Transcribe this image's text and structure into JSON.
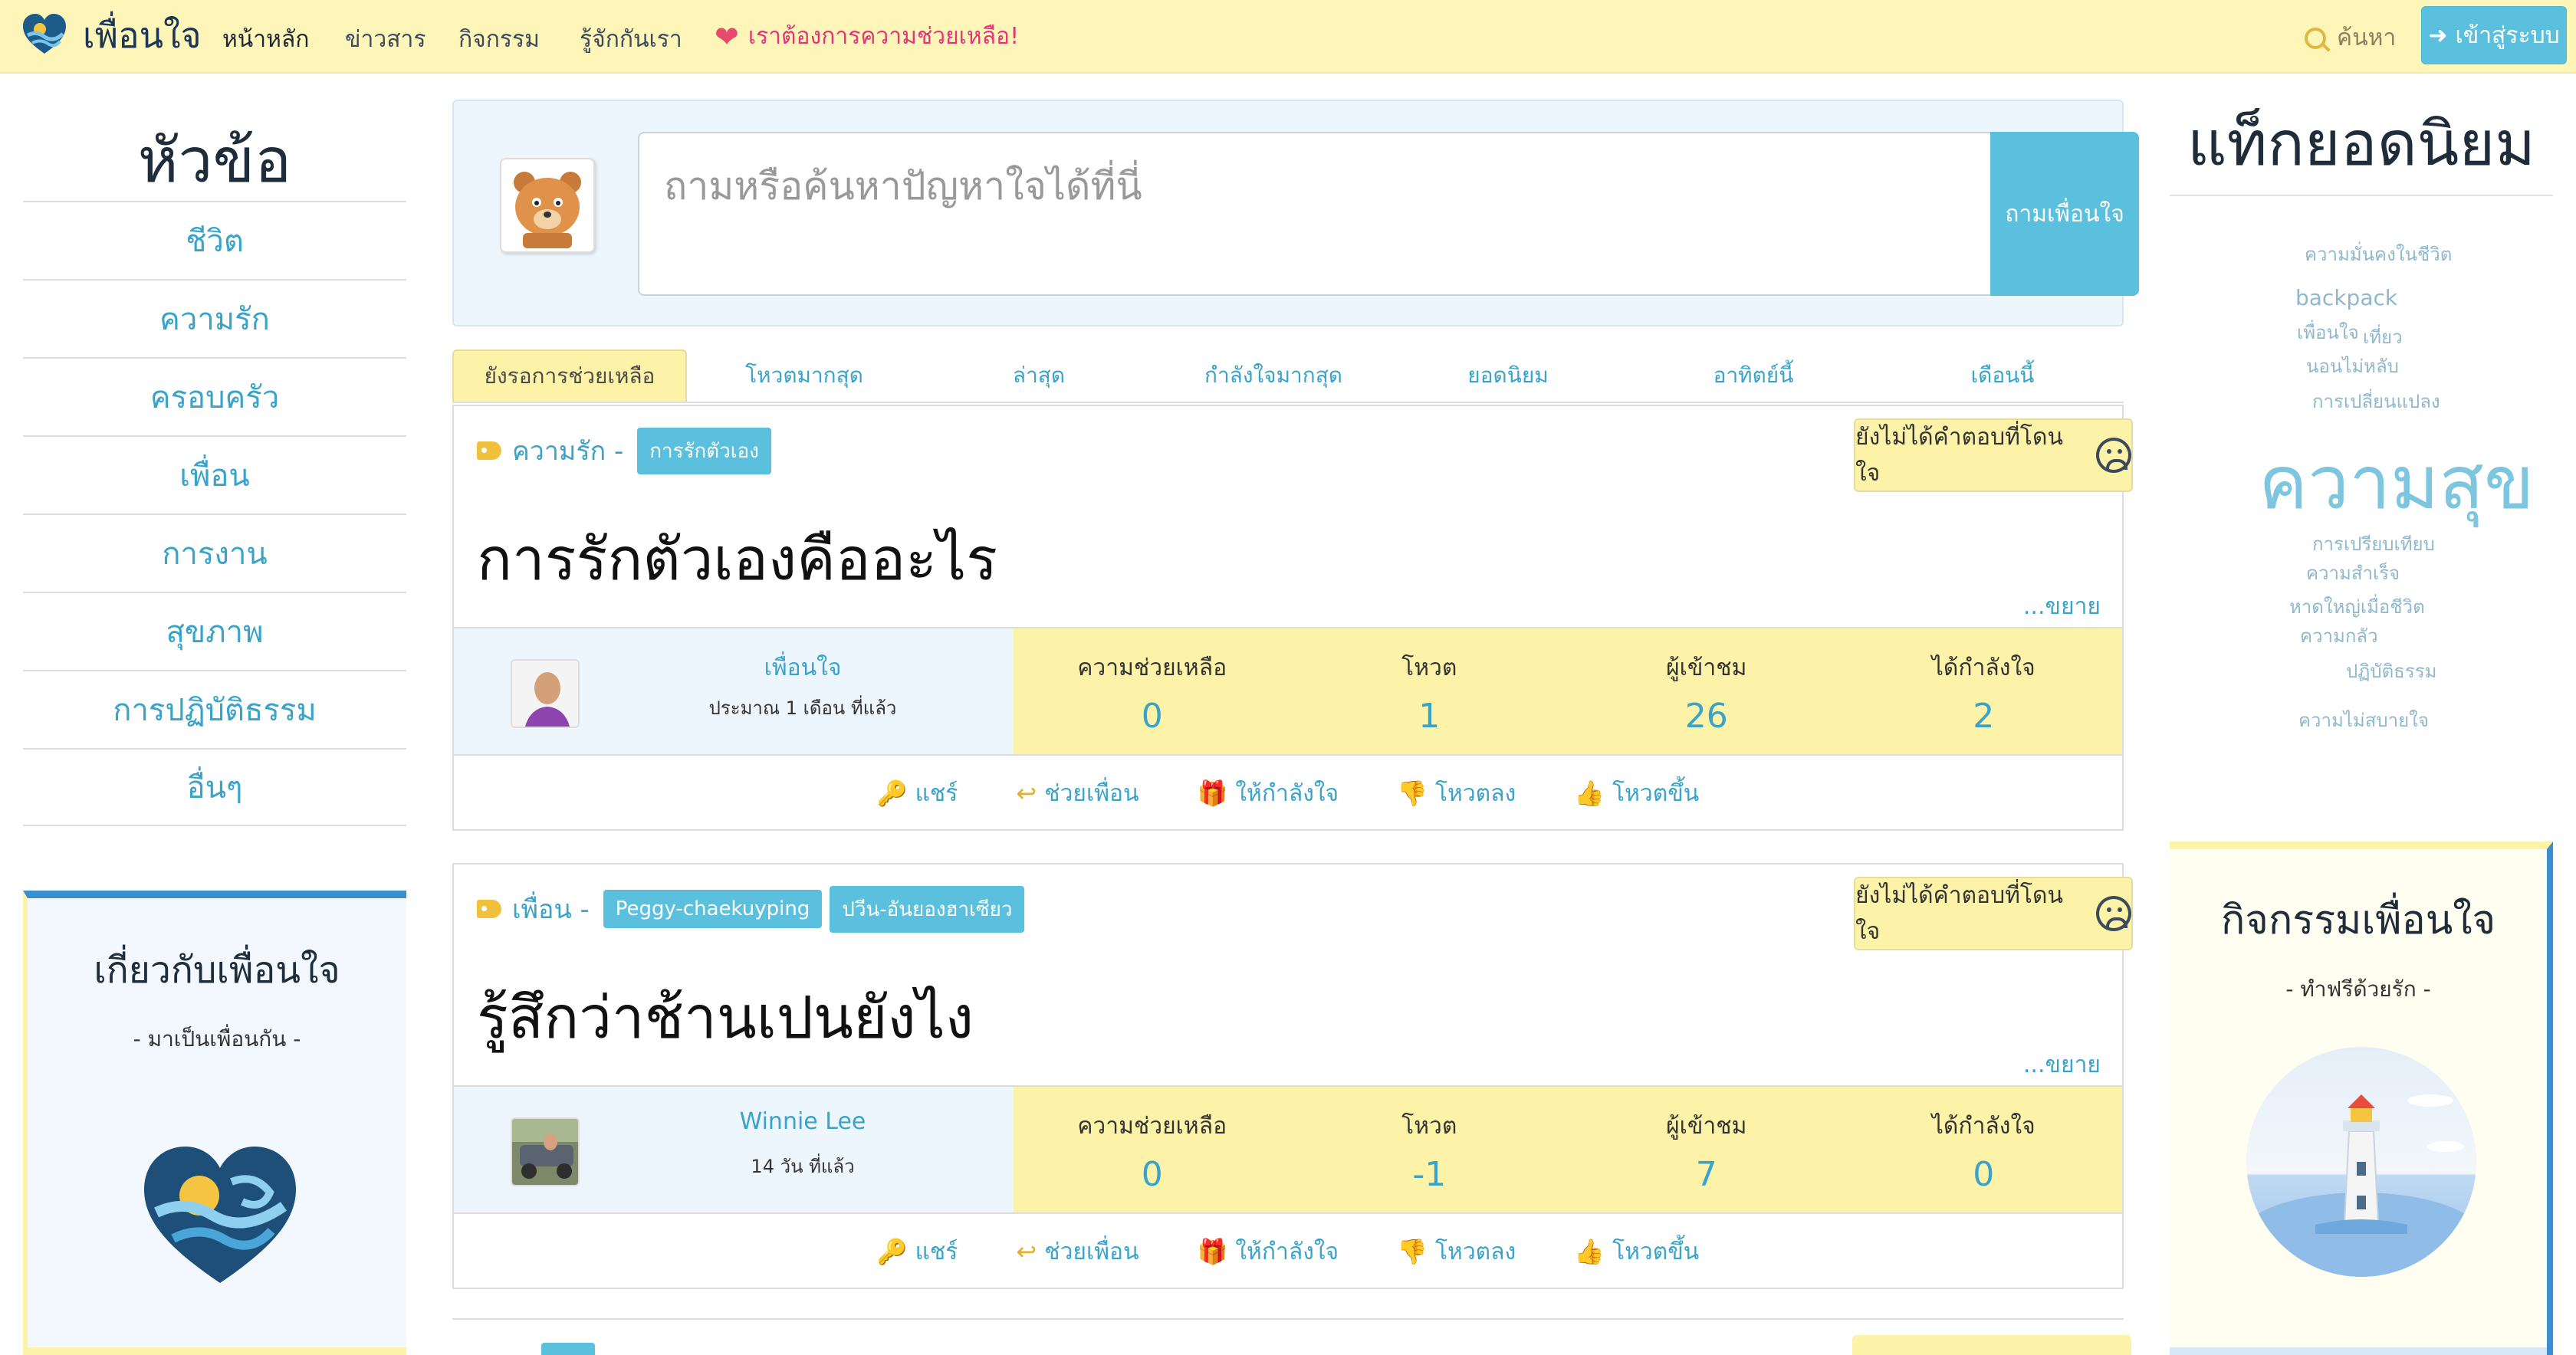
{
  "brand": {
    "name": "เพื่อนใจ"
  },
  "nav": {
    "home": "หน้าหลัก",
    "news": "ข่าวสาร",
    "activities": "กิจกรรม",
    "about": "รู้จักกันเรา",
    "help": "เราต้องการความช่วยเหลือ!",
    "search": "ค้นหา",
    "login": "เข้าสู่ระบบ"
  },
  "sidebar": {
    "title": "หัวข้อ",
    "topics": [
      "ชีวิต",
      "ความรัก",
      "ครอบครัว",
      "เพื่อน",
      "การงาน",
      "สุขภาพ",
      "การปฏิบัติธรรม",
      "อื่นๆ"
    ],
    "about_title": "เกี่ยวกับเพื่อนใจ",
    "about_sub": "- มาเป็นเพื่อนกัน -"
  },
  "ask": {
    "placeholder": "ถามหรือค้นหาปัญหาใจได้ที่นี่",
    "button": "ถามเพื่อนใจ"
  },
  "tabs": [
    "ยังรอการช่วยเหลือ",
    "โหวตมากสุด",
    "ล่าสุด",
    "กำลังใจมากสุด",
    "ยอดนิยม",
    "อาทิตย์นี้",
    "เดือนนี้"
  ],
  "stat_labels": {
    "help": "ความช่วยเหลือ",
    "vote": "โหวต",
    "views": "ผู้เข้าชม",
    "cheers": "ได้กำลังใจ"
  },
  "actions": {
    "share": "แชร์",
    "help": "ช่วยเพื่อน",
    "cheer": "ให้กำลังใจ",
    "down": "โหวตลง",
    "up": "โหวตขึ้น"
  },
  "unanswered": "ยังไม่ได้คำตอบที่โดนใจ",
  "expand": "...ขยาย",
  "posts": [
    {
      "category": "ความรัก -",
      "tags": [
        "การรักตัวเอง"
      ],
      "title": "การรักตัวเองคืออะไร",
      "author": "เพื่อนใจ",
      "time": "ประมาณ 1 เดือน ที่แล้ว",
      "help": "0",
      "vote": "1",
      "views": "26",
      "cheers": "2"
    },
    {
      "category": "เพื่อน -",
      "tags": [
        "Peggy-chaekuyping",
        "ปวีน-อันยองฮาเซียว"
      ],
      "title": "รู้สึกว่าช้านเปนยังไง",
      "author": "Winnie Lee",
      "time": "14 วัน ที่แล้ว",
      "help": "0",
      "vote": "-1",
      "views": "7",
      "cheers": "0"
    }
  ],
  "tag_cloud": {
    "title": "แท็กยอดนิยม",
    "tags": [
      "ความมั่นคงในชีวิต",
      "backpack",
      "เพื่อนใจ",
      "เที่ยว",
      "นอนไม่หลับ",
      "การเปลี่ยนแปลง",
      "ความสุข",
      "การเปรียบเทียบ",
      "ความสำเร็จ",
      "หาดใหญ่เมื่อชีวิต",
      "ความกลัว",
      "ปฏิบัติธรรม",
      "ความไม่สบายใจ"
    ]
  },
  "activity": {
    "title": "กิจกรรมเพื่อนใจ",
    "sub": "- ทำฟรีด้วยรัก -"
  },
  "colors": {
    "navbar": "#fdf6b8",
    "accent": "#5bc0de",
    "link": "#3aa3c9",
    "stats_bg": "#fdf3a8",
    "help_red": "#e0367c"
  }
}
